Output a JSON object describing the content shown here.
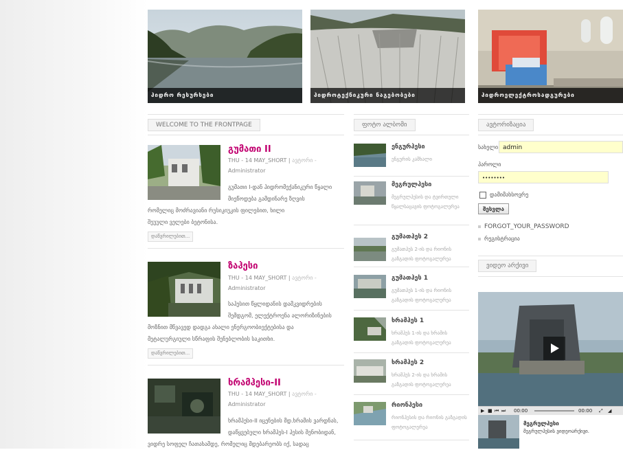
{
  "banners": [
    {
      "caption": "ჰიდრო რესურსები"
    },
    {
      "caption": "ჰიდროტექნიკური ნაგებობები"
    },
    {
      "caption": "ჰიდროელექტროსადგურები"
    }
  ],
  "main": {
    "heading": "WELCOME TO THE FRONTPAGE",
    "read_more": "დაწვრილებით...",
    "articles": [
      {
        "title": "გუმათი II",
        "date": "THU - 14 MAY_SHORT",
        "category": "ავტორი -",
        "author": "Administrator",
        "body_lines": [
          "გუმათი I-დან ჰიდრომექანიკური წყალი",
          "მიეწოდება გამდინარე ზღვის",
          "რომელიც მოძრავიანი რუსიკიუკის ფილებით, ხილი",
          "შეუული ველები ბეტონისა."
        ]
      },
      {
        "title": "ზაჰესი",
        "date": "THU - 14 MAY_SHORT",
        "category": "ავტორი -",
        "author": "Administrator",
        "body_lines": [
          "საჰესით წყლიდანის დამკვიდრების",
          "შემდგომ, ელექტროენა ალორიზინების",
          "მოზნით მწვავედ დადგა ახალი ენერგოობიექტებისა და",
          "მეტალურგიული სწრაფის შენებლობის საკითხი."
        ]
      },
      {
        "title": "ხრამჰესი-II",
        "date": "THU - 14 MAY_SHORT",
        "category": "ავტორი -",
        "author": "Administrator",
        "body_lines": [
          "ხრამჰესი-II იცენების მდ.ხრამის ვარდნას,",
          "დაწყვებული ხრამჰეს-I ჰესის შენობიდან,",
          "ვიდრე სოფელ ჩათახამდე, რომელიც მდებარეობს იქ, სადაც"
        ]
      }
    ]
  },
  "gallery": {
    "heading": "ფოტო ალბომი",
    "items": [
      {
        "title": "ენგურჰესი",
        "desc": "ენგურის კაშხალი"
      },
      {
        "title": "მეგრულჰესი",
        "desc": "მეგრულჰესის და ტვირთული წყალსაცავის ფოტოგალერეა"
      },
      {
        "title": "გუმათჰეს 2",
        "desc": "გუმათჰეს 2-ის და რიონის გაზგადის ფოტოგალერეა"
      },
      {
        "title": "გუმათჰეს 1",
        "desc": "გუმათჰეს 1-ის და რიონის გაზგადის ფოტოგალერეა"
      },
      {
        "title": "ხრამჰეს 1",
        "desc": "ხრამჰეს 1-ის და ხრამის გაზგადის ფოტოგალერეა"
      },
      {
        "title": "ხრამჰეს 2",
        "desc": "ხრამჰეს 2-ის და ხრამის გაზგადის ფოტოგალერეა"
      },
      {
        "title": "რიონჰესი",
        "desc": "რიონჰესის და რიონის გაზგადის ფოტოგალერეა"
      }
    ]
  },
  "login": {
    "heading": "ავტორიზაცია",
    "username_label": "სახელი",
    "username_value": "admin",
    "password_label": "პაროლი",
    "password_value": "••••••••",
    "remember_label": "დამიმახსოვრე",
    "submit_label": "შესვლა",
    "forgot_label": "FORGOT_YOUR_PASSWORD",
    "register_label": "რეგისტრაცია"
  },
  "video": {
    "heading": "ვიდეო არქივი",
    "time_current": "00:00",
    "time_total": "00:00",
    "item_title": "მეგრულჰესი",
    "item_desc": "მეგრულჰესის ვიდეოარქივი."
  },
  "colors": {
    "accent": "#c1006f",
    "field_bg": "#ffffcc"
  }
}
